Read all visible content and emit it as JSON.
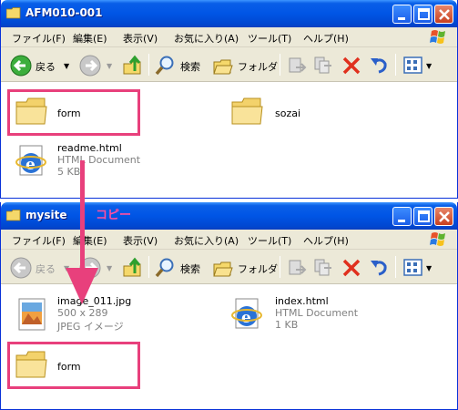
{
  "window_a": {
    "title": "AFM010-001",
    "menu": [
      "ファイル(F)",
      "編集(E)",
      "表示(V)",
      "お気に入り(A)",
      "ツール(T)",
      "ヘルプ(H)"
    ],
    "toolbar": {
      "back": "戻る",
      "search": "検索",
      "folders": "フォルダ"
    },
    "items": [
      {
        "name": "form",
        "icon": "folder-icon"
      },
      {
        "name": "sozai",
        "icon": "folder-icon"
      },
      {
        "name": "readme.html",
        "type": "HTML Document",
        "size": "5 KB",
        "icon": "ie-html-icon"
      }
    ]
  },
  "window_b": {
    "title": "mysite",
    "menu": [
      "ファイル(F)",
      "編集(E)",
      "表示(V)",
      "お気に入り(A)",
      "ツール(T)",
      "ヘルプ(H)"
    ],
    "toolbar": {
      "back": "戻る",
      "search": "検索",
      "folders": "フォルダ"
    },
    "items": [
      {
        "name": "image_011.jpg",
        "dimensions": "500 x 289",
        "type": "JPEG イメージ",
        "icon": "jpeg-image-icon"
      },
      {
        "name": "index.html",
        "type": "HTML Document",
        "size": "1 KB",
        "icon": "ie-html-icon"
      },
      {
        "name": "form",
        "icon": "folder-icon"
      }
    ]
  },
  "annotation": {
    "label": "コピー",
    "color": "#e8407c"
  }
}
